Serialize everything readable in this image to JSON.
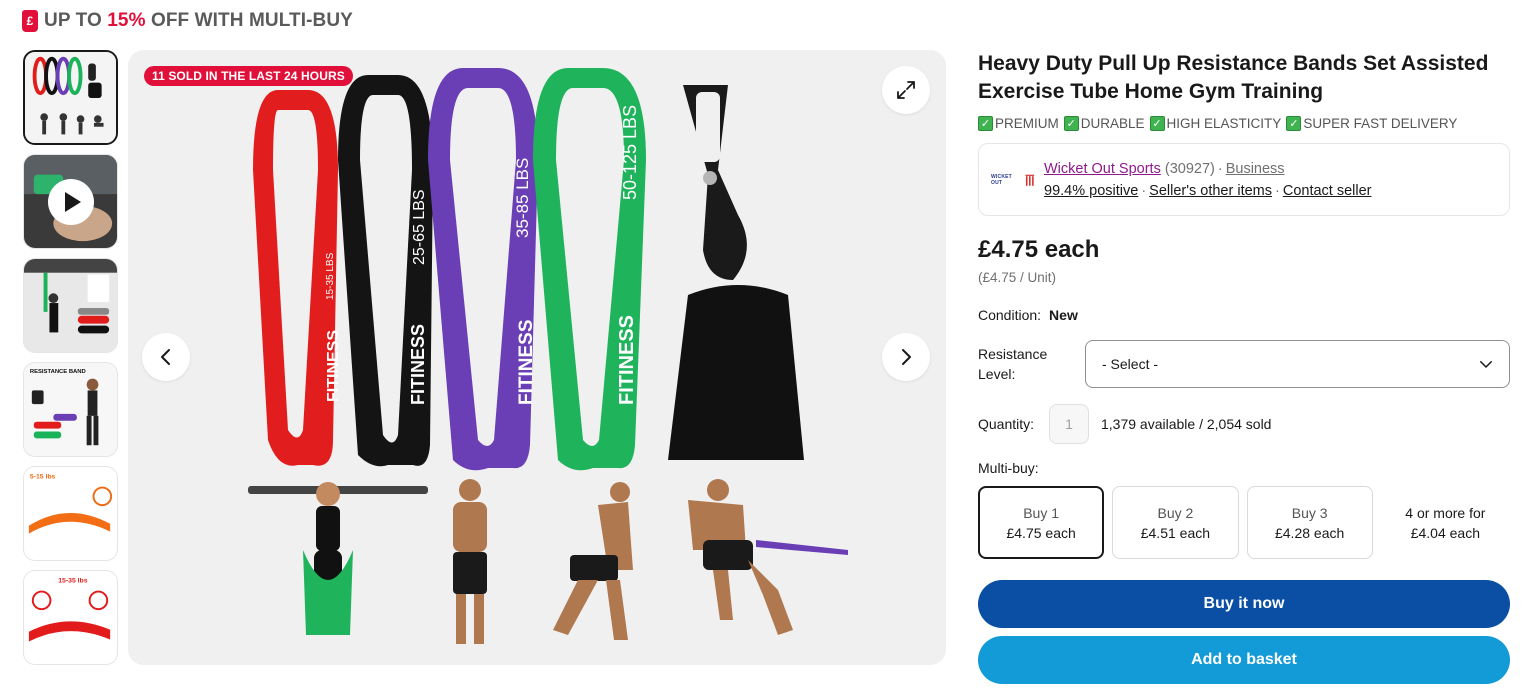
{
  "promo": {
    "prefix": "UP TO ",
    "percent": "15%",
    "suffix": " OFF WITH MULTI-BUY",
    "tag_icon": "price-tag-icon"
  },
  "gallery": {
    "sold_badge": "11 SOLD IN THE LAST 24 HOURS",
    "thumbnails": [
      "bands-set",
      "video",
      "door-anchor",
      "woman-exercising",
      "orange-band",
      "red-band"
    ],
    "band_labels": [
      "15-35 LBS",
      "25-65 LBS",
      "35-85 LBS",
      "50-125 LBS"
    ],
    "band_brand": "FITINESS",
    "thumb_labels": {
      "t4": "RESISTANCE BAND",
      "t5": "5-15 lbs",
      "t6": "15-35 lbs"
    }
  },
  "product": {
    "title": "Heavy Duty Pull Up Resistance Bands Set Assisted Exercise Tube Home Gym Training",
    "features": [
      "PREMIUM",
      "DURABLE",
      "HIGH ELASTICITY",
      "SUPER FAST DELIVERY"
    ],
    "price": "£4.75 each",
    "unit_price": "(£4.75 / Unit)",
    "condition_label": "Condition:",
    "condition_value": "New"
  },
  "seller": {
    "logo_text": "WICKET OUT",
    "name": "Wicket Out Sports",
    "feedback_count": "(30927)",
    "type": "Business",
    "positive": "99.4% positive",
    "other_items": "Seller's other items",
    "contact": "Contact seller"
  },
  "options": {
    "resistance_label": "Resistance Level:",
    "resistance_value": "- Select -",
    "quantity_label": "Quantity:",
    "quantity_value": "1",
    "availability": "1,379 available / 2,054 sold"
  },
  "multibuy": {
    "label": "Multi-buy:",
    "tiers": [
      {
        "top": "Buy 1",
        "bottom": "£4.75 each"
      },
      {
        "top": "Buy 2",
        "bottom": "£4.51 each"
      },
      {
        "top": "Buy 3",
        "bottom": "£4.28 each"
      }
    ],
    "more_top": "4 or more for",
    "more_bottom": "£4.04 each"
  },
  "actions": {
    "buy_now": "Buy it now",
    "add_to_basket": "Add to basket"
  },
  "colors": {
    "promo_red": "#e0103a",
    "buy_blue": "#0a4fa3",
    "basket_blue": "#129bd6",
    "seller_purple": "#8d1a8d"
  }
}
